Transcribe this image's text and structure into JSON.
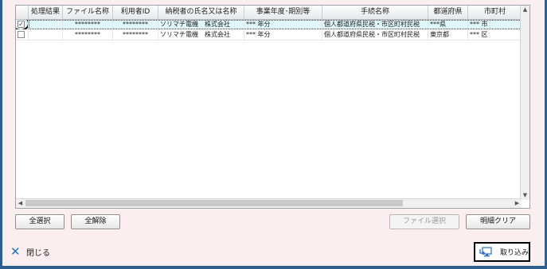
{
  "grid": {
    "columns": [
      "",
      "処理結果",
      "ファイル名称",
      "利用者ID",
      "納税者の氏名又は名称",
      "事業年度･期別等",
      "手続名称",
      "都道府県",
      "市町村"
    ],
    "rows": [
      {
        "checked": true,
        "check_glyph": "✓",
        "result": "",
        "file_name": "********",
        "user_id": "********",
        "taxpayer": "ソリマチ電機　株式会社",
        "fiscal_year": "*** 年分",
        "procedure": "個人都道府県民税・市区町村民税",
        "prefecture": "***県",
        "municipality": "*** 市"
      },
      {
        "checked": false,
        "check_glyph": "",
        "result": "",
        "file_name": "********",
        "user_id": "********",
        "taxpayer": "ソリマチ電機　株式会社",
        "fiscal_year": "*** 年分",
        "procedure": "個人都道府県民税・市区町村民税",
        "prefecture": "東京都",
        "municipality": "*** 区"
      }
    ]
  },
  "buttons": {
    "select_all": "全選択",
    "deselect_all": "全解除",
    "file_select": "ファイル選択",
    "clear_details": "明細クリア",
    "close": "閉じる",
    "import": "取り込み"
  },
  "icons": {
    "close": "close-x-icon",
    "import": "import-monitor-icon",
    "scroll_up": "▲",
    "scroll_down": "▼",
    "scroll_left": "◀",
    "scroll_right": "▶"
  },
  "colors": {
    "background": "#fbeef1",
    "selected_row": "#dff6fb",
    "accent": "#2b6fc4",
    "frame": "#2d5f8f"
  }
}
